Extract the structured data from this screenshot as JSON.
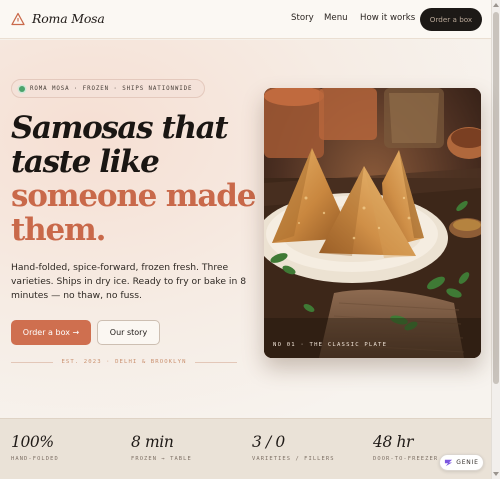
{
  "header": {
    "brand": "Roma Mosa",
    "nav": [
      {
        "label": "Story"
      },
      {
        "label": "Menu"
      },
      {
        "label": "How it works"
      }
    ],
    "order_button": "Order a box"
  },
  "hero": {
    "pill": "ROMA MOSA · FROZEN · SHIPS NATIONWIDE",
    "headline_line1": "Samosas that",
    "headline_line2": "taste like",
    "headline_line3": "someone made",
    "headline_line4": "them.",
    "description": "Hand-folded, spice-forward, frozen fresh. Three varieties. Ships in dry ice. Ready to fry or bake in 8 minutes — no thaw, no fuss.",
    "primary_button": "Order a box →",
    "secondary_button": "Our story",
    "est": "EST. 2023 · DELHI & BROOKLYN",
    "photo_caption": "NO 01 · THE CLASSIC PLATE"
  },
  "stats": [
    {
      "value": "100%",
      "label": "HAND-FOLDED"
    },
    {
      "value": "8 min",
      "label": "FROZEN → TABLE"
    },
    {
      "value": "3 / 0",
      "label": "VARIETIES / FILLERS"
    },
    {
      "value": "48 hr",
      "label": "DOOR-TO-FREEZER"
    }
  ],
  "genie": {
    "label": "GENIE"
  },
  "colors": {
    "accent": "#cf6f4f",
    "dark": "#1c1916",
    "status_dot": "#4aa36b",
    "background": "#f6f1ea"
  },
  "icons": {
    "brand": "triangle-logo-icon",
    "genie": "genie-spark-icon"
  }
}
